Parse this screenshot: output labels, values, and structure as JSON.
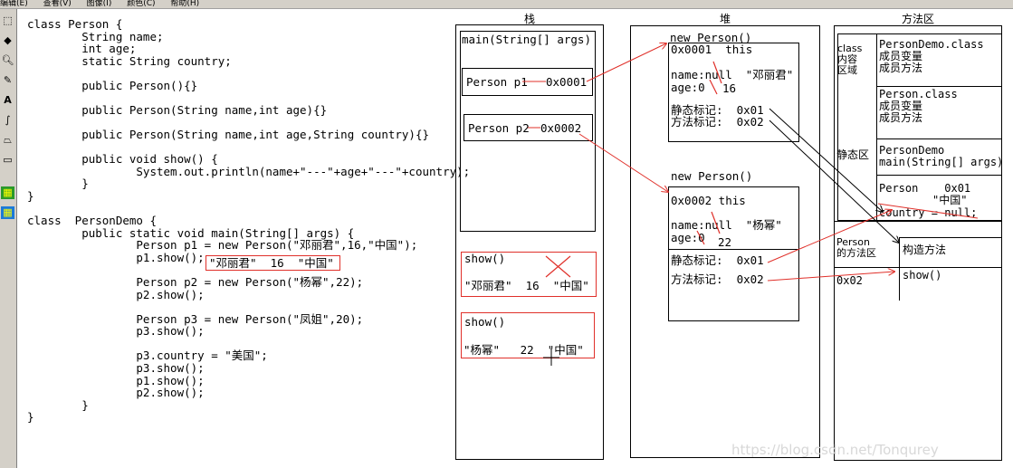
{
  "menu": [
    "编辑(E)",
    "查看(V)",
    "图像(I)",
    "颜色(C)",
    "帮助(H)"
  ],
  "tools": [
    "select-icon",
    "fill-icon",
    "magnifier-icon",
    "pencil-icon",
    "text-icon",
    "curve-icon",
    "polygon-icon",
    "rounded-rect-icon",
    "tool-selected-a-icon",
    "tool-selected-b-icon"
  ],
  "code": {
    "l1": "class Person {",
    "l2": "        String name;",
    "l3": "        int age;",
    "l4": "        static String country;",
    "l5": "        public Person(){}",
    "l6": "        public Person(String name,int age){}",
    "l7": "        public Person(String name,int age,String country){}",
    "l8": "        public void show() {",
    "l9": "                System.out.println(name+\"---\"+age+\"---\"+country);",
    "l10": "        }",
    "l11": "}",
    "l12": "class  PersonDemo {",
    "l13": "        public static void main(String[] args) {",
    "l14": "                Person p1 = new Person(\"邓丽君\",16,\"中国\");",
    "l15": "                p1.show();",
    "l15b": "\"邓丽君\"  16  \"中国\"",
    "l16": "                Person p2 = new Person(\"杨幂\",22);",
    "l17": "                p2.show();",
    "l18": "                Person p3 = new Person(\"凤姐\",20);",
    "l19": "                p3.show();",
    "l20": "                p3.country = \"美国\";",
    "l21": "                p3.show();",
    "l22": "                p1.show();",
    "l23": "                p2.show();",
    "l24": "        }",
    "l25": "}"
  },
  "stack": {
    "title": "栈",
    "main": "main(String[] args)",
    "p1": "Person p1",
    "p1addr": "0x0001",
    "p2": "Person p2",
    "p2addr": "0x0002",
    "show1_title": "show()",
    "show1_values": "\"邓丽君\"  16  \"中国\"",
    "show2_title": "show()",
    "show2_values": "\"杨幂\"   22  \"中国\""
  },
  "heap": {
    "title": "堆",
    "obj1_title": "new Person()",
    "obj1_addr": "0x0001  this",
    "obj1_name": "name:null  \"邓丽君\"",
    "obj1_age": "age:0",
    "obj1_age_val": "16",
    "obj1_static": "静态标记:  0x01",
    "obj1_method": "方法标记:  0x02",
    "obj2_title": "new Person()",
    "obj2_addr": "0x0002 this",
    "obj2_name": "name:null  \"杨幂\"",
    "obj2_age": "age:0",
    "obj2_age_val": "22",
    "obj2_static": "静态标记:  0x01",
    "obj2_method": "方法标记:  0x02"
  },
  "method_area": {
    "title": "方法区",
    "class_area": "class\n内容\n区域",
    "persondemo_class": "PersonDemo.class\n成员变量\n成员方法",
    "person_class": "Person.class\n成员变量\n成员方法",
    "static_area": "静态区",
    "static_demo": "PersonDemo\nmain(String[] args)",
    "static_person": "Person    0x01",
    "static_country_val": "\"中国\"",
    "static_country": "country = null;",
    "person_methods": "Person\n的方法区",
    "person_methods_addr": "0x02",
    "constructor": "构造方法",
    "show": "show()"
  },
  "watermark": "https://blog.csdn.net/Tonqurey"
}
